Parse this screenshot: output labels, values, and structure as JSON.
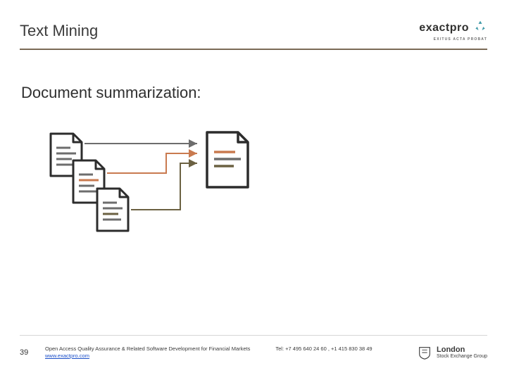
{
  "title": "Text Mining",
  "section_heading": "Document summarization:",
  "logo": {
    "text": "exactpro",
    "tagline": "EXITUS ACTA PROBAT"
  },
  "footer": {
    "page_number": "39",
    "description": "Open Access Quality Assurance & Related Software Development for Financial Markets",
    "link": "www.exactpro.com",
    "contact": "Tel: +7 495 640 24 60 ,  +1 415 830 38 49",
    "lseg_line1": "London",
    "lseg_line2": "Stock Exchange Group"
  },
  "colors": {
    "doc_stroke": "#2c2c2c",
    "doc_fill": "#ffffff",
    "accent_orange": "#c97a4f",
    "accent_grey": "#6d6d6d",
    "accent_olive": "#6b6142",
    "rule": "#7a6a56"
  }
}
